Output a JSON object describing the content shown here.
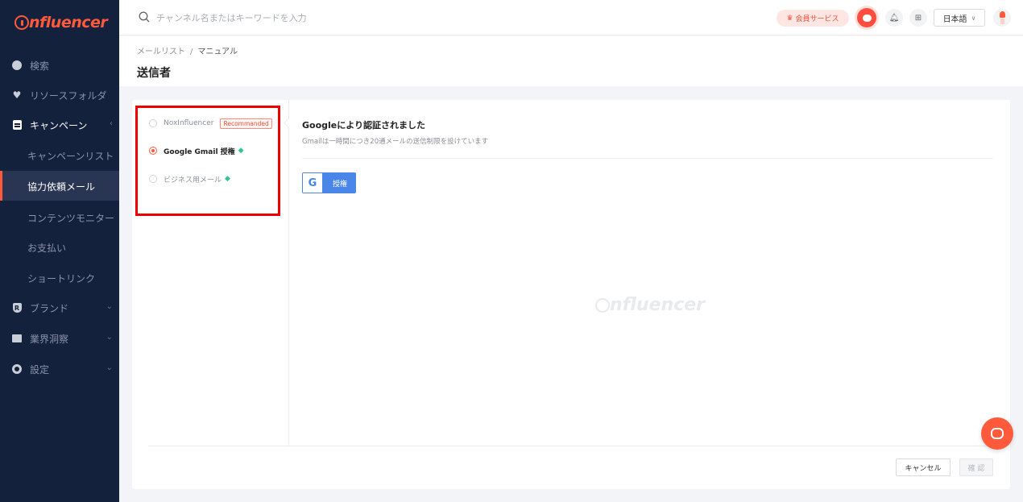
{
  "brand": {
    "logo_text": "nfluencer",
    "accent": "#ff5a3c",
    "sidebar_bg": "#14213d"
  },
  "search": {
    "placeholder": "チャンネル名またはキーワードを入力"
  },
  "topbar": {
    "member_label": "会員サービス",
    "language": "日本語"
  },
  "sidebar": {
    "items": [
      {
        "label": "検索",
        "icon": "compass-icon"
      },
      {
        "label": "リソースフォルダ",
        "icon": "heart-icon"
      },
      {
        "label": "キャンペーン",
        "icon": "document-icon",
        "expanded": true
      },
      {
        "label": "キャンペーンリスト"
      },
      {
        "label": "協力依頼メール",
        "active": true
      },
      {
        "label": "コンテンツモニター"
      },
      {
        "label": "お支払い"
      },
      {
        "label": "ショートリンク"
      },
      {
        "label": "ブランド",
        "icon": "brand-icon"
      },
      {
        "label": "業界洞察",
        "icon": "insight-chart-icon"
      },
      {
        "label": "設定",
        "icon": "gear-icon"
      }
    ]
  },
  "breadcrumb": {
    "parent": "メールリスト",
    "separator": "/",
    "current": "マニュアル"
  },
  "page": {
    "title": "送信者"
  },
  "sender_options": [
    {
      "label": "NoxInfluencer",
      "badge": "Recommanded",
      "selected": false
    },
    {
      "label": "Google Gmail 授権",
      "selected": true
    },
    {
      "label": "ビジネス用メール",
      "selected": false
    }
  ],
  "auth": {
    "title": "Googleにより認証されました",
    "subtitle": "Gmailは一時間につき20通メールの送信制限を設けています",
    "google_button": "授権",
    "google_letter": "G"
  },
  "watermark": "nfluencer",
  "footer": {
    "cancel": "キャンセル",
    "confirm": "確 認"
  }
}
